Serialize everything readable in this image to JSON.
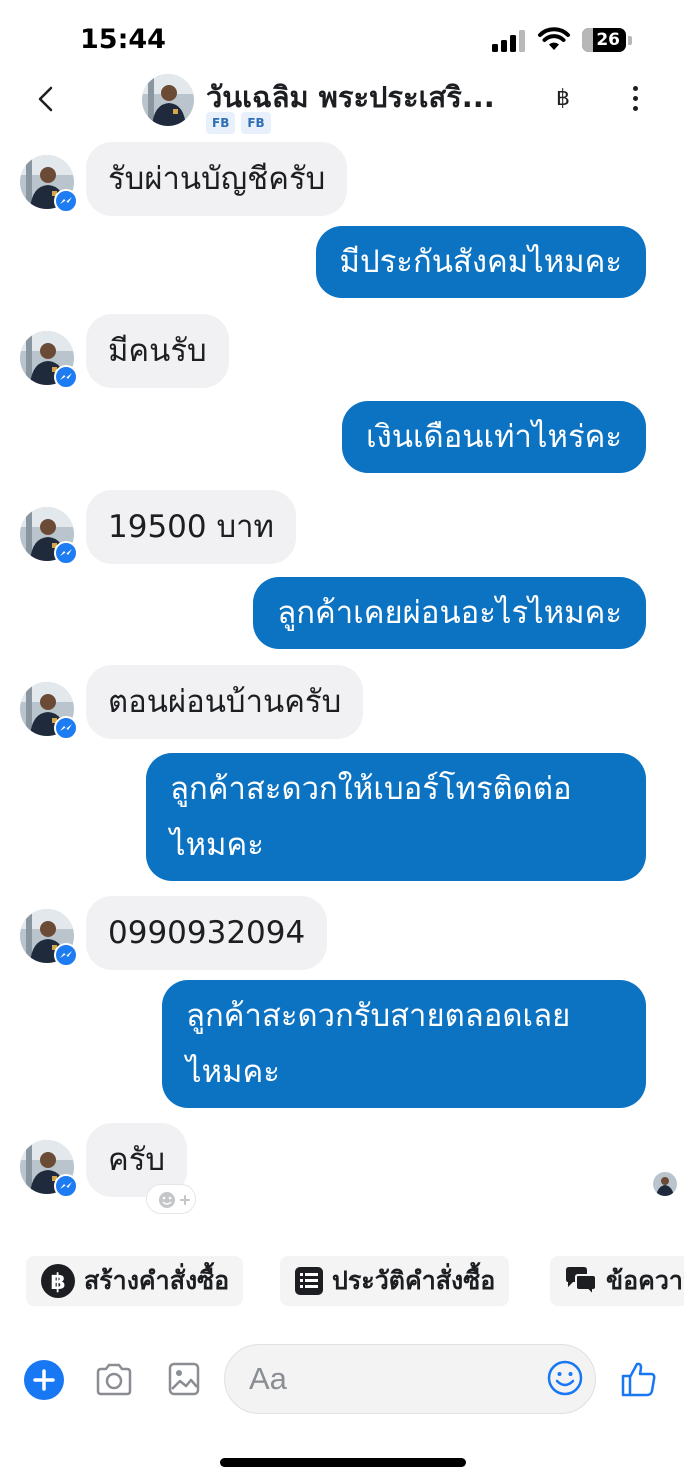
{
  "status_bar": {
    "time": "15:44",
    "battery": "26",
    "battery_level": 0.26
  },
  "header": {
    "contact_name": "วันเฉลิม พระประเสริ...",
    "tags": [
      "FB",
      "FB"
    ],
    "currency_symbol": "฿"
  },
  "messages": [
    {
      "from": "contact",
      "text": "รับผ่านบัญชีครับ"
    },
    {
      "from": "me",
      "text": "มีประกันสังคมไหมคะ"
    },
    {
      "from": "contact",
      "text": "มีคนรับ"
    },
    {
      "from": "me",
      "text": "เงินเดือนเท่าไหร่คะ"
    },
    {
      "from": "contact",
      "text": "19500  บาท"
    },
    {
      "from": "me",
      "text": "ลูกค้าเคยผ่อนอะไรไหมคะ"
    },
    {
      "from": "contact",
      "text": "ตอนผ่อนบ้านครับ"
    },
    {
      "from": "me",
      "text": "ลูกค้าสะดวกให้เบอร์โทรติดต่อไหมคะ"
    },
    {
      "from": "contact",
      "text": "0990932094"
    },
    {
      "from": "me",
      "text": "ลูกค้าสะดวกรับสายตลอดเลยไหมคะ"
    },
    {
      "from": "contact",
      "text": "ครับ"
    }
  ],
  "quick_actions": [
    {
      "label": "สร้างคำสั่งซื้อ",
      "icon": "baht-circle-icon"
    },
    {
      "label": "ประวัติคำสั่งซื้อ",
      "icon": "order-list-icon"
    },
    {
      "label": "ข้อความ",
      "icon": "chat-bubbles-icon"
    }
  ],
  "composer": {
    "placeholder": "Aa"
  },
  "colors": {
    "outgoing_bubble": "#0c72c2",
    "incoming_bubble": "#f1f1f3",
    "accent": "#1877f2"
  }
}
